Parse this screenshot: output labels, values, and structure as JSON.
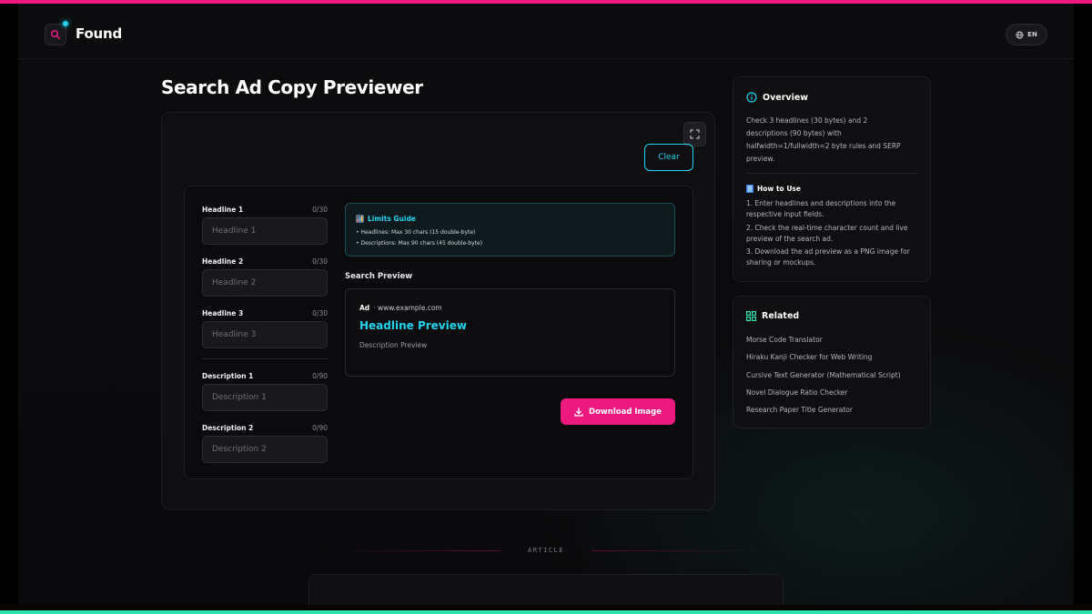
{
  "app": {
    "name": "Found",
    "lang": "EN"
  },
  "page": {
    "title": "Search Ad Copy Previewer"
  },
  "toolbar": {
    "clear_label": "Clear",
    "download_label": "Download Image"
  },
  "fields": [
    {
      "label": "Headline 1",
      "count": "0/30",
      "placeholder": "Headline 1",
      "value": ""
    },
    {
      "label": "Headline 2",
      "count": "0/30",
      "placeholder": "Headline 2",
      "value": ""
    },
    {
      "label": "Headline 3",
      "count": "0/30",
      "placeholder": "Headline 3",
      "value": ""
    },
    {
      "label": "Description 1",
      "count": "0/90",
      "placeholder": "Description 1",
      "value": ""
    },
    {
      "label": "Description 2",
      "count": "0/90",
      "placeholder": "Description 2",
      "value": ""
    }
  ],
  "limits": {
    "title": "Limits Guide",
    "lines": [
      "• Headlines: Max 30 chars (15 double-byte)",
      "• Descriptions: Max 90 chars (45 double-byte)"
    ]
  },
  "preview": {
    "heading": "Search Preview",
    "ad_tag": "Ad",
    "url": "· www.example.com",
    "headline": "Headline Preview",
    "description": "Description Preview"
  },
  "overview": {
    "title": "Overview",
    "text": "Check 3 headlines (30 bytes) and 2 descriptions (90 bytes) with halfwidth=1/fullwidth=2 byte rules and SERP preview.",
    "howto_title": "How to Use",
    "steps": [
      "1. Enter headlines and descriptions into the respective input fields.",
      "2. Check the real-time character count and live preview of the search ad.",
      "3. Download the ad preview as a PNG image for sharing or mockups."
    ]
  },
  "related": {
    "title": "Related",
    "links": [
      "Morse Code Translator",
      "Hiraku Kanji Checker for Web Writing",
      "Cursive Text Generator (Mathematical Script)",
      "Novel Dialogue Ratio Checker",
      "Research Paper Title Generator"
    ]
  },
  "article": {
    "label": "ARTICLE"
  },
  "colors": {
    "accent_pink": "#ec1a7f",
    "accent_cyan": "#22d3ee",
    "accent_green": "#2fe0b0"
  }
}
